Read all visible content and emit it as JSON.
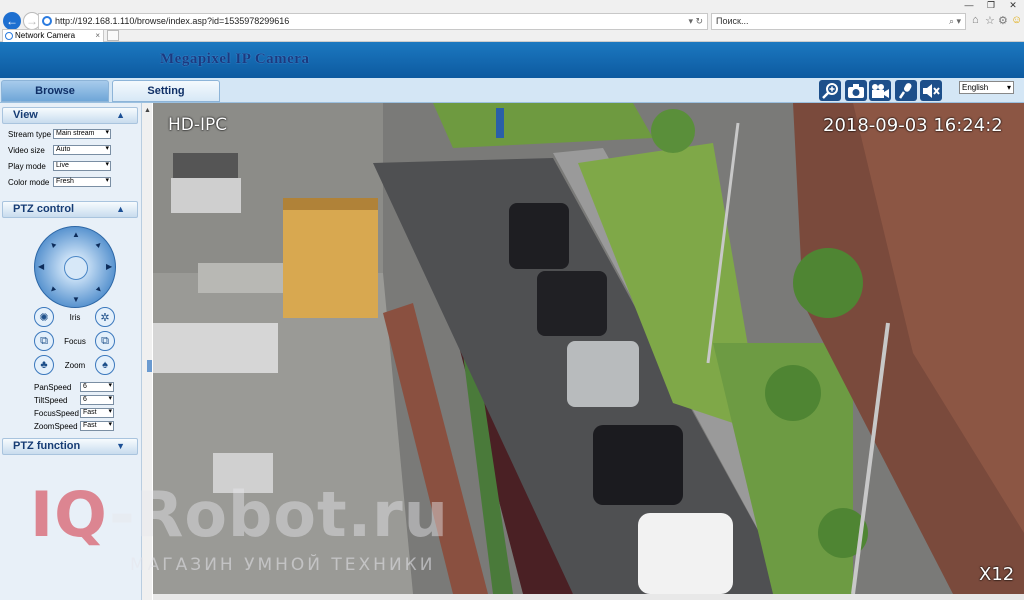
{
  "browser": {
    "url": "http://192.168.1.110/browse/index.asp?id=1535978299616",
    "search_placeholder": "Поиск...",
    "tab_title": "Network Camera",
    "tab_close": "×",
    "window_controls": [
      "—",
      "❐",
      "✕"
    ]
  },
  "app": {
    "title": "Megapixel IP Camera"
  },
  "tabs": [
    {
      "label": "Browse",
      "active": true
    },
    {
      "label": "Setting",
      "active": false
    }
  ],
  "toolbar": {
    "icons": [
      "zoom-in-icon",
      "snapshot-camera-icon",
      "record-video-icon",
      "microphone-icon",
      "speaker-mute-icon"
    ],
    "language": "English"
  },
  "view_panel": {
    "title": "View",
    "rows": [
      {
        "label": "Stream type",
        "value": "Main stream"
      },
      {
        "label": "Video size",
        "value": "Auto"
      },
      {
        "label": "Play mode",
        "value": "Live"
      },
      {
        "label": "Color mode",
        "value": "Fresh"
      }
    ]
  },
  "ptz_panel": {
    "title": "PTZ control",
    "iris_label": "Iris",
    "focus_label": "Focus",
    "zoom_label": "Zoom",
    "speeds": [
      {
        "label": "PanSpeed",
        "value": "6"
      },
      {
        "label": "TiltSpeed",
        "value": "6"
      },
      {
        "label": "FocusSpeed",
        "value": "Fast"
      },
      {
        "label": "ZoomSpeed",
        "value": "Fast"
      }
    ]
  },
  "ptz_function": {
    "title": "PTZ function"
  },
  "video": {
    "osd_name": "HD-IPC",
    "timestamp": "2018-09-03 16:24:2",
    "zoom": "X12"
  },
  "watermark": {
    "brand_red": "IQ",
    "brand_rest": "-Robot.ru",
    "tagline": "МАГАЗИН УМНОЙ ТЕХНИКИ"
  },
  "colors": {
    "header_blue": "#0d5aa0",
    "accent": "#1d4f8a",
    "brand_red": "#d22d3c"
  }
}
